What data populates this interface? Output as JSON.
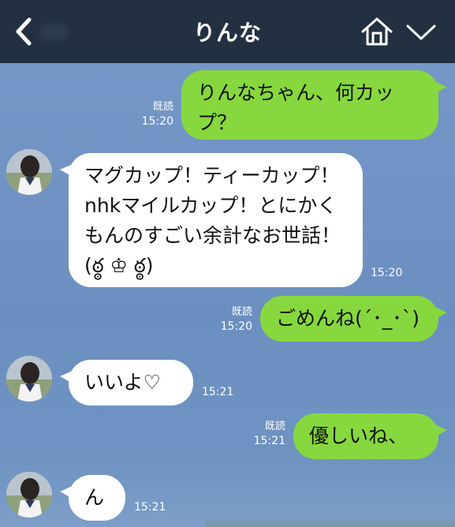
{
  "header": {
    "title": "りんな",
    "back_icon": "chevron-left-icon",
    "home_icon": "home-icon",
    "menu_icon": "chevron-down-icon"
  },
  "colors": {
    "header_bg": "#223041",
    "chat_bg": "#6f95c4",
    "sent_bubble": "#86d83e",
    "received_bubble": "#ffffff"
  },
  "messages": [
    {
      "direction": "sent",
      "text": "りんなちゃん、何カップ？",
      "status": "既読",
      "time": "15:20"
    },
    {
      "direction": "received",
      "text": "マグカップ！ティーカップ！nhkマイルカップ！とにかくもんのすごい余計なお世話！(ఠ్ఠ ♔ ఠ్ఠ)",
      "time": "15:20"
    },
    {
      "direction": "sent",
      "text": "ごめんね(´･_･`)",
      "status": "既読",
      "time": "15:20"
    },
    {
      "direction": "received",
      "text": "いいよ♡",
      "time": "15:21"
    },
    {
      "direction": "sent",
      "text": "優しいね、",
      "status": "既読",
      "time": "15:21"
    },
    {
      "direction": "received",
      "text": "ん",
      "time": "15:21"
    }
  ]
}
